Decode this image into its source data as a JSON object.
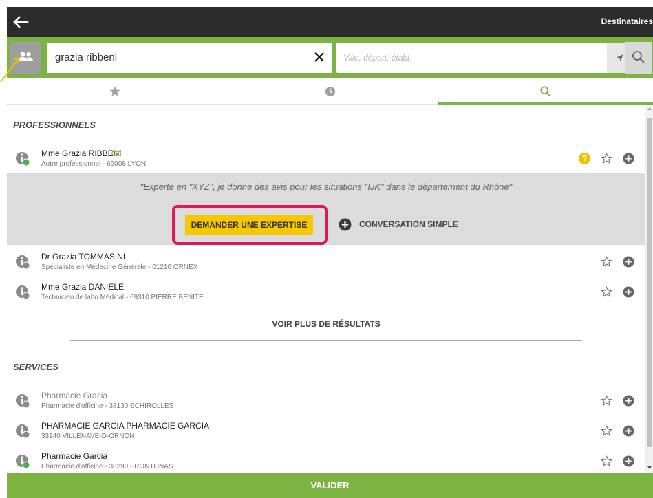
{
  "header": {
    "title": "Destinataires",
    "back_icon": "arrow-left-icon"
  },
  "search": {
    "group_icon": "users-icon",
    "name_value": "grazia ribbeni",
    "location_placeholder": "Ville, départ, établ.",
    "clear_icon": "close-icon",
    "locate_icon": "location-arrow-icon",
    "search_icon": "search-icon"
  },
  "tabs": [
    {
      "icon": "star-icon",
      "active": false
    },
    {
      "icon": "clock-icon",
      "active": false
    },
    {
      "icon": "search-icon",
      "active": true
    }
  ],
  "professionals": {
    "title": "PROFESSIONNELS",
    "items": [
      {
        "name": "Mme Grazia RIBBENI",
        "subtitle": "Autre professionnel - 69008 LYON",
        "status": "green",
        "has_help": true
      },
      {
        "name": "Dr Grazia TOMMASINI",
        "subtitle": "Spécialiste en Médecine Générale - 01210 ORNEX",
        "status": "grey"
      },
      {
        "name": "Mme Grazia DANIELE",
        "subtitle": "Technicien de labo Médical - 69310 PIERRE BENITE",
        "status": "grey"
      }
    ],
    "expanded": {
      "quote": "\"Experte en \"XYZ\", je donne des avis pour les situations \"IJK\" dans le département du Rhône\"",
      "expertise_label": "DEMANDER UNE EXPERTISE",
      "conversation_label": "CONVERSATION SIMPLE"
    },
    "more_label": "VOIR PLUS DE RÉSULTATS"
  },
  "services": {
    "title": "SERVICES",
    "items": [
      {
        "name": "Pharmacie Gracia",
        "subtitle": "Pharmacie d'officine - 38130 ECHIROLLES",
        "status": "grey",
        "muted": true
      },
      {
        "name": "PHARMACIE GARCIA PHARMACIE GARCIA",
        "subtitle": "33140 VILLENAVE-D-ORNON",
        "status": "grey"
      },
      {
        "name": "Pharmacie Garcia",
        "subtitle": "Pharmacie d'officine - 38290 FRONTONAS",
        "status": "green"
      }
    ]
  },
  "footer": {
    "validate_label": "VALIDER"
  },
  "colors": {
    "accent": "#7cb342",
    "highlight": "#e0185a",
    "button": "#f7c800",
    "help": "#f2c200"
  }
}
